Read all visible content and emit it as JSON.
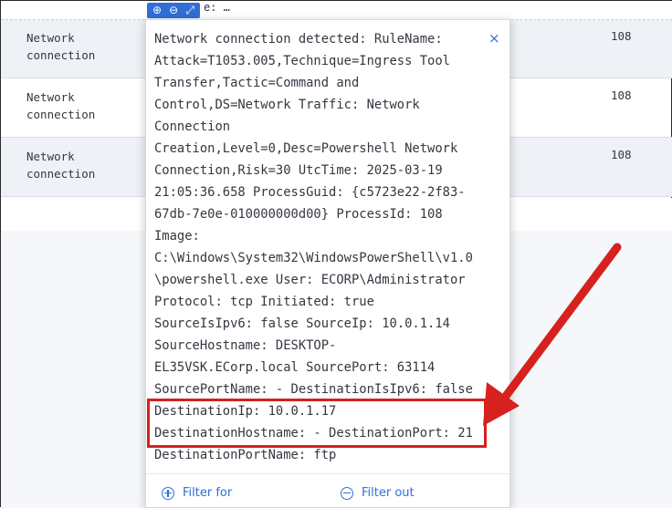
{
  "header": {
    "fragment": "e: …",
    "toolbar_icons": [
      "zoom-in-icon",
      "zoom-out-icon",
      "expand-icon"
    ],
    "toolbar_glyphs": [
      "⊕",
      "⊖",
      "⤢"
    ]
  },
  "rows": [
    {
      "event": "Network\nconnection",
      "value": "108"
    },
    {
      "event": "Network\nconnection",
      "value": "108"
    },
    {
      "event": "Network\nconnection",
      "value": "108"
    }
  ],
  "popup": {
    "close_glyph": "×",
    "message": "Network connection detected: RuleName:\nAttack=T1053.005,Technique=Ingress Tool\nTransfer,Tactic=Command and\nControl,DS=Network Traffic: Network\nConnection\nCreation,Level=0,Desc=Powershell Network\nConnection,Risk=30 UtcTime: 2025-03-19\n21:05:36.658 ProcessGuid: {c5723e22-2f83-\n67db-7e0e-010000000d00} ProcessId: 108\nImage:\nC:\\Windows\\System32\\WindowsPowerShell\\v1.0\n\\powershell.exe User: ECORP\\Administrator\nProtocol: tcp Initiated: true\nSourceIsIpv6: false SourceIp: 10.0.1.14\nSourceHostname: DESKTOP-\nEL35VSK.ECorp.local SourcePort: 63114\nSourcePortName: - DestinationIsIpv6: false\nDestinationIp: 10.0.1.17\nDestinationHostname: - DestinationPort: 21\nDestinationPortName: ftp",
    "filter_for_label": "Filter for",
    "filter_out_label": "Filter out"
  },
  "annotation": {
    "color": "#d6211f"
  }
}
